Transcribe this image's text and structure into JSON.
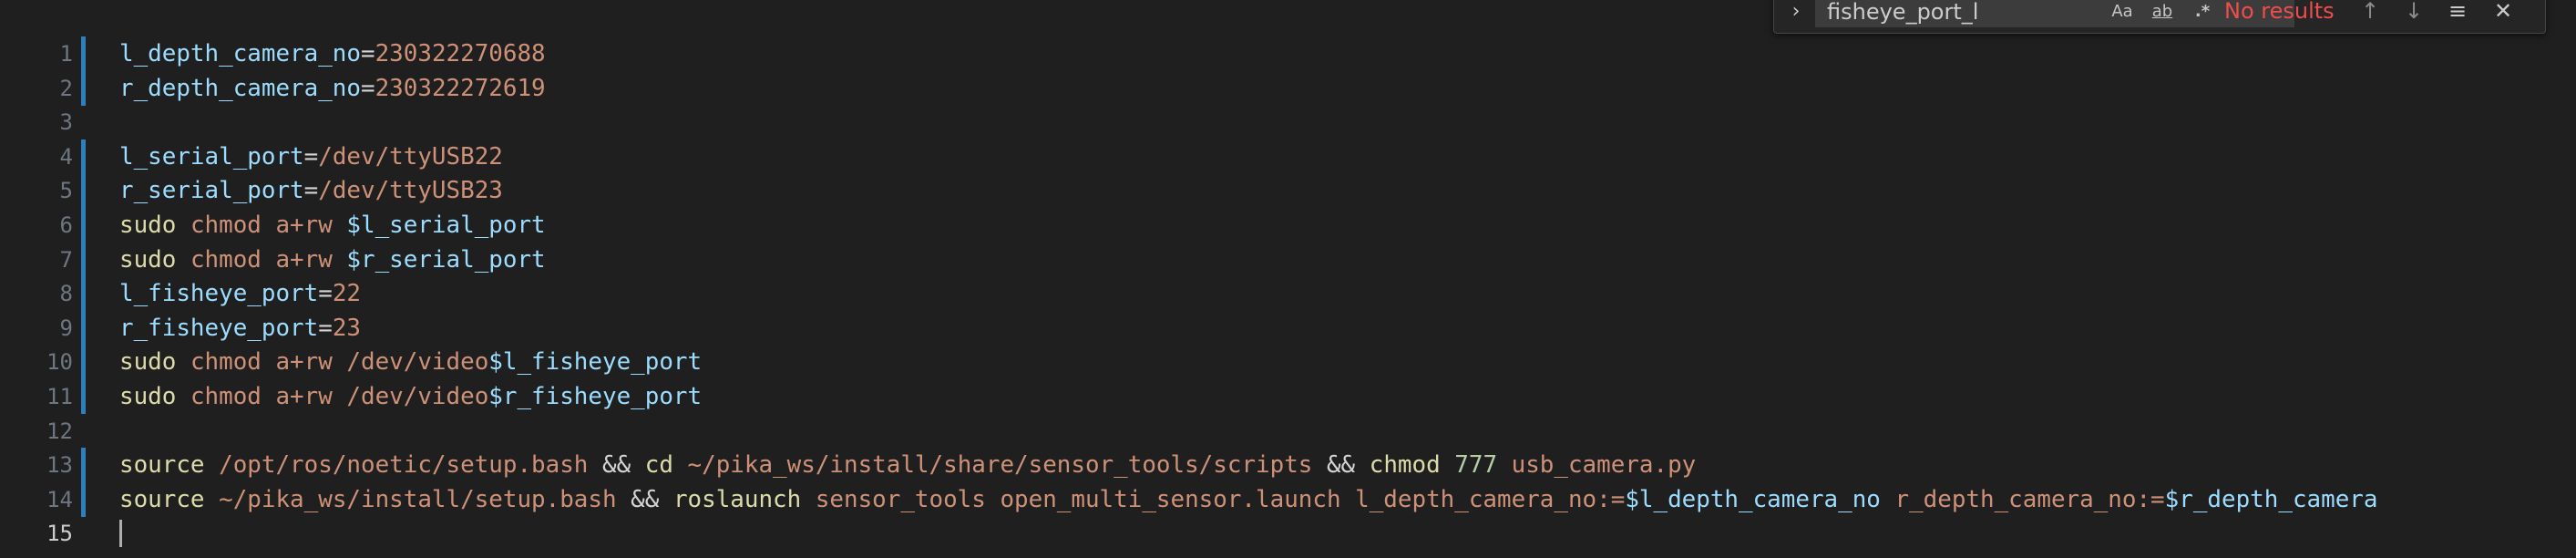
{
  "editor": {
    "line_numbers": [
      "1",
      "2",
      "3",
      "4",
      "5",
      "6",
      "7",
      "8",
      "9",
      "10",
      "11",
      "12",
      "13",
      "14",
      "15"
    ],
    "lines": [
      {
        "tokens": [
          {
            "t": "l_depth_camera_no",
            "c": "var"
          },
          {
            "t": "=",
            "c": "op"
          },
          {
            "t": "230322270688",
            "c": "str"
          }
        ]
      },
      {
        "tokens": [
          {
            "t": "r_depth_camera_no",
            "c": "var"
          },
          {
            "t": "=",
            "c": "op"
          },
          {
            "t": "230322272619",
            "c": "str"
          }
        ]
      },
      {
        "tokens": []
      },
      {
        "tokens": [
          {
            "t": "l_serial_port",
            "c": "var"
          },
          {
            "t": "=",
            "c": "op"
          },
          {
            "t": "/dev/ttyUSB22",
            "c": "str"
          }
        ]
      },
      {
        "tokens": [
          {
            "t": "r_serial_port",
            "c": "var"
          },
          {
            "t": "=",
            "c": "op"
          },
          {
            "t": "/dev/ttyUSB23",
            "c": "str"
          }
        ]
      },
      {
        "tokens": [
          {
            "t": "sudo ",
            "c": "kw"
          },
          {
            "t": "chmod ",
            "c": "str"
          },
          {
            "t": "a+rw ",
            "c": "str"
          },
          {
            "t": "$l_serial_port",
            "c": "var"
          }
        ]
      },
      {
        "tokens": [
          {
            "t": "sudo ",
            "c": "kw"
          },
          {
            "t": "chmod ",
            "c": "str"
          },
          {
            "t": "a+rw ",
            "c": "str"
          },
          {
            "t": "$r_serial_port",
            "c": "var"
          }
        ]
      },
      {
        "tokens": [
          {
            "t": "l_fisheye_port",
            "c": "var"
          },
          {
            "t": "=",
            "c": "op"
          },
          {
            "t": "22",
            "c": "str"
          }
        ]
      },
      {
        "tokens": [
          {
            "t": "r_fisheye_port",
            "c": "var"
          },
          {
            "t": "=",
            "c": "op"
          },
          {
            "t": "23",
            "c": "str"
          }
        ]
      },
      {
        "tokens": [
          {
            "t": "sudo ",
            "c": "kw"
          },
          {
            "t": "chmod ",
            "c": "str"
          },
          {
            "t": "a+rw /dev/video",
            "c": "str"
          },
          {
            "t": "$l_fisheye_port",
            "c": "var"
          }
        ]
      },
      {
        "tokens": [
          {
            "t": "sudo ",
            "c": "kw"
          },
          {
            "t": "chmod ",
            "c": "str"
          },
          {
            "t": "a+rw /dev/video",
            "c": "str"
          },
          {
            "t": "$r_fisheye_port",
            "c": "var"
          }
        ]
      },
      {
        "tokens": []
      },
      {
        "tokens": [
          {
            "t": "source ",
            "c": "kw"
          },
          {
            "t": "/opt/ros/noetic/setup.bash ",
            "c": "str"
          },
          {
            "t": "&& ",
            "c": "op"
          },
          {
            "t": "cd ",
            "c": "kw"
          },
          {
            "t": "~/pika_ws/install/share/sensor_tools/scripts ",
            "c": "str"
          },
          {
            "t": "&& ",
            "c": "op"
          },
          {
            "t": "chmod ",
            "c": "kw"
          },
          {
            "t": "777 ",
            "c": "num"
          },
          {
            "t": "usb_camera.py",
            "c": "str"
          }
        ]
      },
      {
        "tokens": [
          {
            "t": "source ",
            "c": "kw"
          },
          {
            "t": "~/pika_ws/install/setup.bash ",
            "c": "str"
          },
          {
            "t": "&& ",
            "c": "op"
          },
          {
            "t": "roslaunch ",
            "c": "kw"
          },
          {
            "t": "sensor_tools open_multi_sensor.launch l_depth_camera_no:=",
            "c": "str"
          },
          {
            "t": "$l_depth_camera_no ",
            "c": "var"
          },
          {
            "t": "r_depth_camera_no:=",
            "c": "str"
          },
          {
            "t": "$r_depth_camera",
            "c": "var"
          }
        ]
      },
      {
        "tokens": []
      }
    ],
    "active_line": 15,
    "modified_lines": [
      1,
      2,
      4,
      5,
      6,
      7,
      8,
      9,
      10,
      11,
      13,
      14
    ]
  },
  "find_widget": {
    "toggle_icon": "chevron-right-icon",
    "query": "fisheye_port_l",
    "match_case_label": "Aa",
    "match_word_label": "ab",
    "regex_label": ".*",
    "status": "No results",
    "prev_icon": "arrow-up-icon",
    "next_icon": "arrow-down-icon",
    "in_selection_icon": "selection-icon",
    "close_icon": "close-icon"
  },
  "colors": {
    "background": "#1f1f1f",
    "variable": "#9cdcfe",
    "string": "#ce9178",
    "keyword": "#dcdcaa",
    "number": "#b5cea8",
    "modified_gutter": "#2f7fbf",
    "no_results": "#f14c4c"
  }
}
